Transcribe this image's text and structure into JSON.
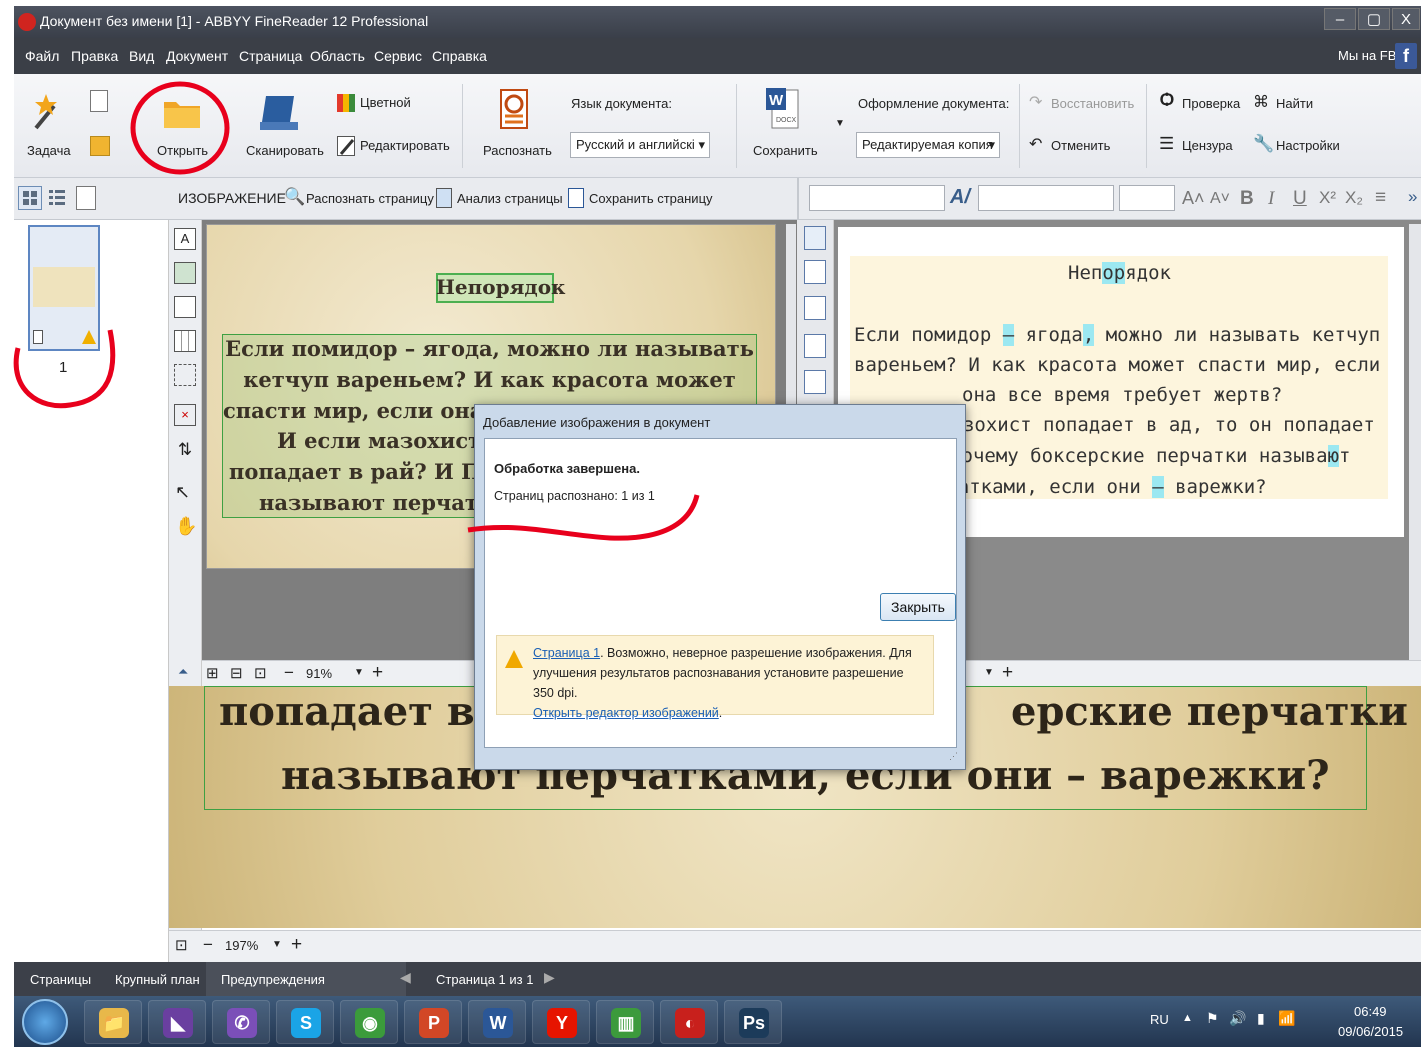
{
  "window": {
    "title": "Документ без имени [1] - ABBYY FineReader 12 Professional",
    "controls": [
      "–",
      "▢",
      "X"
    ]
  },
  "menu": {
    "items": [
      "Файл",
      "Правка",
      "Вид",
      "Документ",
      "Страница",
      "Область",
      "Сервис",
      "Справка"
    ],
    "fb_label": "Мы на FB:",
    "fb_glyph": "f"
  },
  "ribbon": {
    "task": "Задача",
    "open": "Открыть",
    "scan": "Сканировать",
    "color": "Цветной",
    "edit": "Редактировать",
    "recognize": "Распознать",
    "lang_label": "Язык документа:",
    "lang_value": "Русский и английскі",
    "save": "Сохранить",
    "format_label": "Оформление документа:",
    "format_value": "Редактируемая копия",
    "restore": "Восстановить",
    "undo": "Отменить",
    "check": "Проверка",
    "find": "Найти",
    "censor": "Цензура",
    "settings": "Настройки"
  },
  "image_toolbar": {
    "label": "ИЗОБРАЖЕНИЕ",
    "recognize_page": "Распознать страницу",
    "analyze_page": "Анализ страницы",
    "save_page": "Сохранить страницу"
  },
  "format_toolbar": {
    "items": [
      "A˄",
      "A˅",
      "B",
      "I",
      "U",
      "X²",
      "X₂",
      "≡",
      "»"
    ]
  },
  "pages": {
    "thumb_number": "1"
  },
  "image": {
    "title": "Непорядок",
    "lines": [
      "Если помидор – ягода, можно ли называть",
      "кетчуп вареньем? И как красота может",
      "спасти мир, если она",
      "И если мазохист",
      "попадает в рай? И Поч",
      "называют перчаткам"
    ],
    "zoom": "91%"
  },
  "text": {
    "title_a": "Неп",
    "title_hl": "ор",
    "title_b": "ядок",
    "l1_a": "Если помидор ",
    "l1_hl1": "–",
    "l1_b": " ягода",
    "l1_hl2": ",",
    "l1_c": " можно ли называть кетчуп",
    "l2": "вареньем? И как красота может спасти мир, если",
    "l3": "она все время требует жертв?",
    "l4": "И если мазохист попадает в ад, то он попадает",
    "l5_a": "в рай? Почему боксерские перчатки называ",
    "l5_hl": "ю",
    "l5_b": "т",
    "l6_a": "перчатками, если они ",
    "l6_hl": "–",
    "l6_b": " варежки?"
  },
  "zoom_view": {
    "line1_left": "попадает в",
    "line1_right": "ерские перчатки",
    "line2": "называют перчатками, если они – варежки?",
    "zoom": "197%"
  },
  "dialog": {
    "title": "Добавление изображения в документ",
    "heading": "Обработка завершена.",
    "recognized": "Страниц распознано: 1 из 1",
    "close": "Закрыть",
    "warn_link1": "Страница 1",
    "warn_text": ". Возможно, неверное разрешение изображения. Для улучшения результатов распознавания установите разрешение 350 dpi.",
    "warn_link2": "Открыть редактор изображений",
    "warn_end": "."
  },
  "status": {
    "tabs": [
      "Страницы",
      "Крупный план",
      "Предупреждения"
    ],
    "page": "Страница 1 из 1"
  },
  "taskbar": {
    "apps": [
      {
        "name": "explorer",
        "glyph": "📁",
        "color": "#e8b84a"
      },
      {
        "name": "visual-studio",
        "glyph": "◣",
        "color": "#6a3fa0"
      },
      {
        "name": "viber",
        "glyph": "✆",
        "color": "#7b4fb8"
      },
      {
        "name": "skype",
        "glyph": "S",
        "color": "#1aa4e6"
      },
      {
        "name": "chrome",
        "glyph": "◉",
        "color": "#3b9b3b"
      },
      {
        "name": "powerpoint",
        "glyph": "P",
        "color": "#d24726"
      },
      {
        "name": "word",
        "glyph": "W",
        "color": "#2b5797"
      },
      {
        "name": "yandex",
        "glyph": "Y",
        "color": "#e61400"
      },
      {
        "name": "stats",
        "glyph": "▥",
        "color": "#3c9a3c"
      },
      {
        "name": "finereader",
        "glyph": "◐",
        "color": "#c8201c"
      },
      {
        "name": "photoshop",
        "glyph": "Ps",
        "color": "#1c3b5a"
      }
    ],
    "lang": "RU",
    "time": "06:49",
    "date": "09/06/2015"
  }
}
